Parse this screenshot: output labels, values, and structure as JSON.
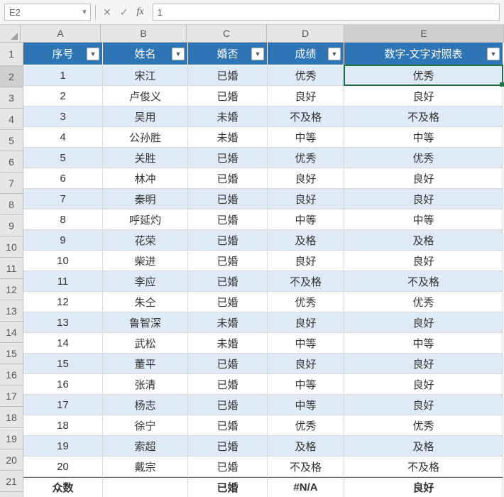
{
  "formula_bar": {
    "name_box": "E2",
    "value": "1"
  },
  "columns": [
    "A",
    "B",
    "C",
    "D",
    "E"
  ],
  "col_widths": {
    "A": 112,
    "B": 120,
    "C": 112,
    "D": 108,
    "E": 224
  },
  "selected_cell": "E2",
  "row_count": 22,
  "header_row": 1,
  "row_pixel_heights": {
    "header": 32,
    "body": 29
  },
  "headers": {
    "A": "序号",
    "B": "姓名",
    "C": "婚否",
    "D": "成绩",
    "E": "数字-文字对照表"
  },
  "rows": [
    {
      "A": "1",
      "B": "宋江",
      "C": "已婚",
      "D": "优秀",
      "E": "优秀"
    },
    {
      "A": "2",
      "B": "卢俊义",
      "C": "已婚",
      "D": "良好",
      "E": "良好"
    },
    {
      "A": "3",
      "B": "吴用",
      "C": "未婚",
      "D": "不及格",
      "E": "不及格"
    },
    {
      "A": "4",
      "B": "公孙胜",
      "C": "未婚",
      "D": "中等",
      "E": "中等"
    },
    {
      "A": "5",
      "B": "关胜",
      "C": "已婚",
      "D": "优秀",
      "E": "优秀"
    },
    {
      "A": "6",
      "B": "林冲",
      "C": "已婚",
      "D": "良好",
      "E": "良好"
    },
    {
      "A": "7",
      "B": "秦明",
      "C": "已婚",
      "D": "良好",
      "E": "良好"
    },
    {
      "A": "8",
      "B": "呼延灼",
      "C": "已婚",
      "D": "中等",
      "E": "中等"
    },
    {
      "A": "9",
      "B": "花荣",
      "C": "已婚",
      "D": "及格",
      "E": "及格"
    },
    {
      "A": "10",
      "B": "柴进",
      "C": "已婚",
      "D": "良好",
      "E": "良好"
    },
    {
      "A": "11",
      "B": "李应",
      "C": "已婚",
      "D": "不及格",
      "E": "不及格"
    },
    {
      "A": "12",
      "B": "朱仝",
      "C": "已婚",
      "D": "优秀",
      "E": "优秀"
    },
    {
      "A": "13",
      "B": "鲁智深",
      "C": "未婚",
      "D": "良好",
      "E": "良好"
    },
    {
      "A": "14",
      "B": "武松",
      "C": "未婚",
      "D": "中等",
      "E": "中等"
    },
    {
      "A": "15",
      "B": "董平",
      "C": "已婚",
      "D": "良好",
      "E": "良好"
    },
    {
      "A": "16",
      "B": "张清",
      "C": "已婚",
      "D": "中等",
      "E": "良好"
    },
    {
      "A": "17",
      "B": "杨志",
      "C": "已婚",
      "D": "中等",
      "E": "良好"
    },
    {
      "A": "18",
      "B": "徐宁",
      "C": "已婚",
      "D": "优秀",
      "E": "优秀"
    },
    {
      "A": "19",
      "B": "索超",
      "C": "已婚",
      "D": "及格",
      "E": "及格"
    },
    {
      "A": "20",
      "B": "戴宗",
      "C": "已婚",
      "D": "不及格",
      "E": "不及格"
    }
  ],
  "summary": {
    "A": "众数",
    "B": "",
    "C": "已婚",
    "D": "#N/A",
    "E": "良好"
  },
  "icons": {
    "dropdown": "▼",
    "cancel": "✕",
    "confirm": "✓"
  }
}
